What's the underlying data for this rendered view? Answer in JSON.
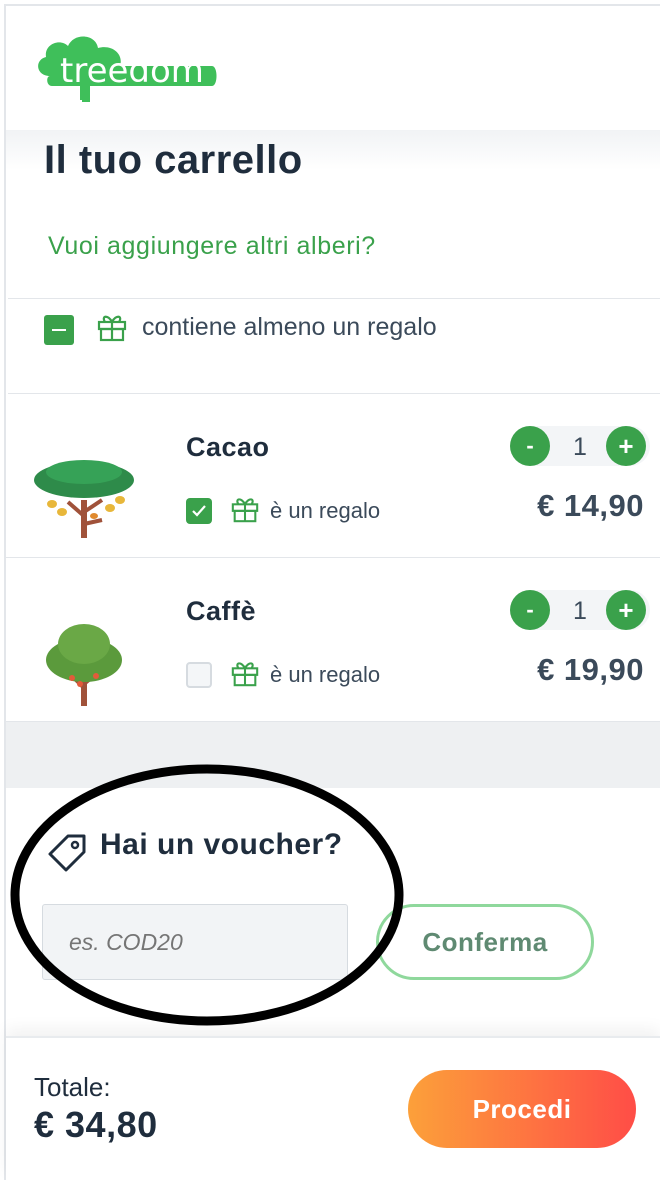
{
  "brand": {
    "logo_text": "treedom",
    "accent": "#3aa14b"
  },
  "cart": {
    "title": "Il tuo carrello",
    "add_more_link": "Vuoi aggiungere altri alberi?",
    "gift_summary": "contiene almeno un regalo",
    "items": [
      {
        "name": "Cacao",
        "qty": "1",
        "qty_minus": "-",
        "qty_plus": "+",
        "gift_label": "è un regalo",
        "gift_checked": true,
        "price": "€ 14,90"
      },
      {
        "name": "Caffè",
        "qty": "1",
        "qty_minus": "-",
        "qty_plus": "+",
        "gift_label": "è un regalo",
        "gift_checked": false,
        "price": "€ 19,90"
      }
    ]
  },
  "voucher": {
    "title": "Hai un voucher?",
    "placeholder": "es. COD20",
    "confirm_label": "Conferma"
  },
  "footer": {
    "total_label": "Totale:",
    "total_value": "€ 34,80",
    "proceed_label": "Procedi"
  }
}
